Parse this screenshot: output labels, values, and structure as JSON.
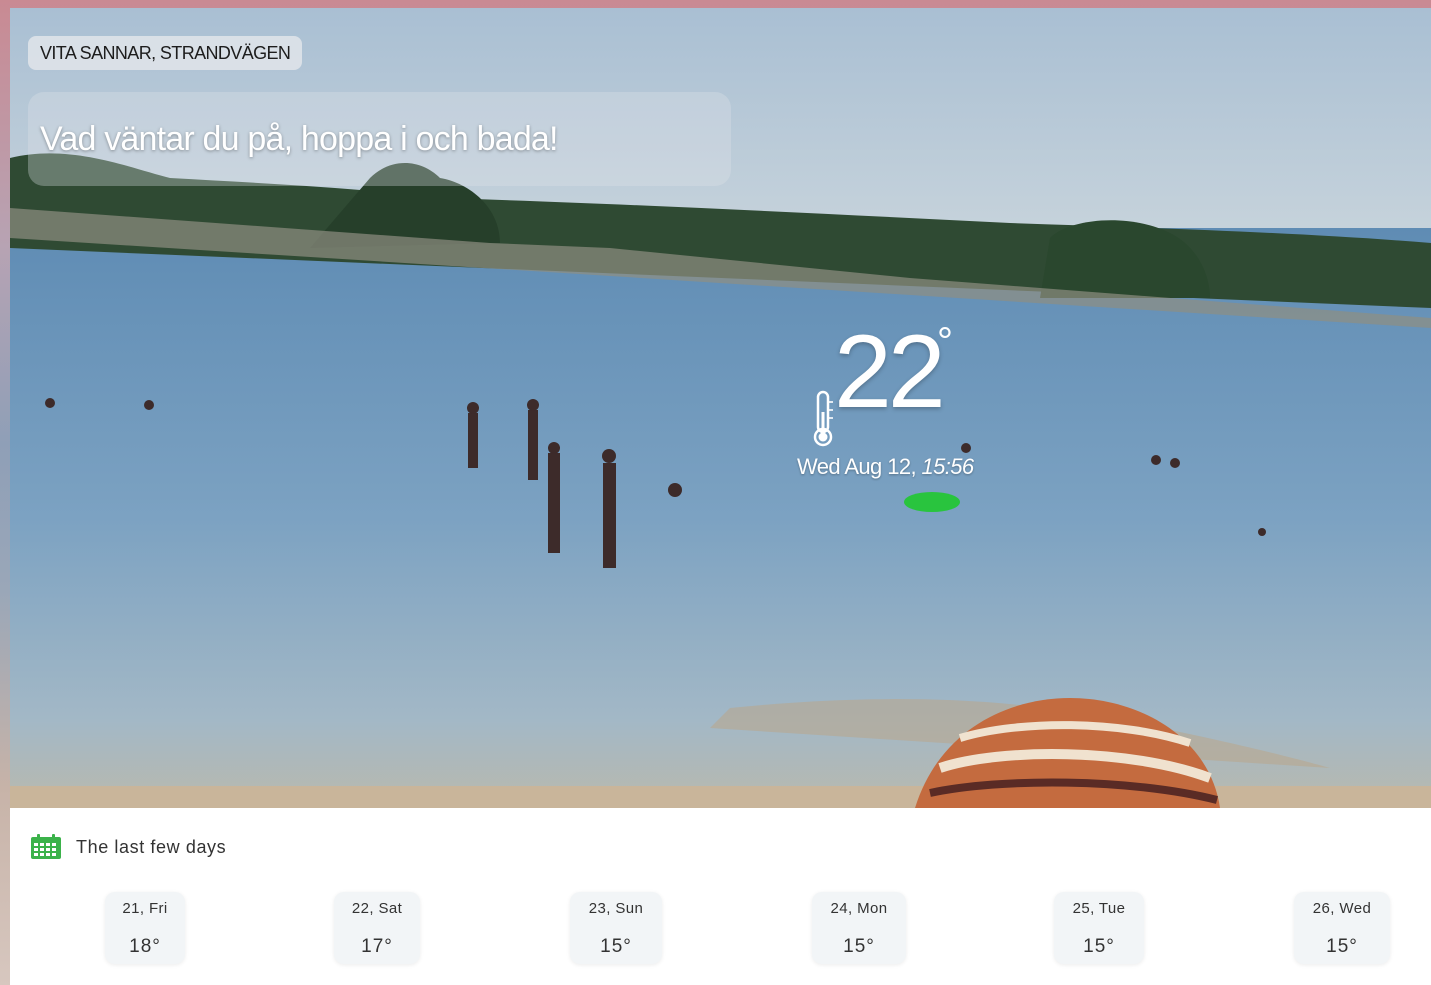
{
  "location": {
    "label": "VITA SANNAR, STRANDVÄGEN"
  },
  "message": {
    "text": "Vad väntar du på, hoppa i och bada!"
  },
  "current": {
    "temperature": "22",
    "unit_symbol": "°",
    "date": "Wed Aug 12,",
    "time": "15:56",
    "icon": "thermometer-icon"
  },
  "forecast": {
    "icon": "calendar-icon",
    "title": "The last few days",
    "days": [
      {
        "label": "21, Fri",
        "temp": "18°"
      },
      {
        "label": "22, Sat",
        "temp": "17°"
      },
      {
        "label": "23, Sun",
        "temp": "15°"
      },
      {
        "label": "24, Mon",
        "temp": "15°"
      },
      {
        "label": "25, Tue",
        "temp": "15°"
      },
      {
        "label": "26, Wed",
        "temp": "15°"
      }
    ]
  },
  "colors": {
    "forecast_icon": "#3bb24a",
    "text_dark": "#333333",
    "panel_bg": "#ffffff",
    "card_bg": "#f2f5f7"
  }
}
